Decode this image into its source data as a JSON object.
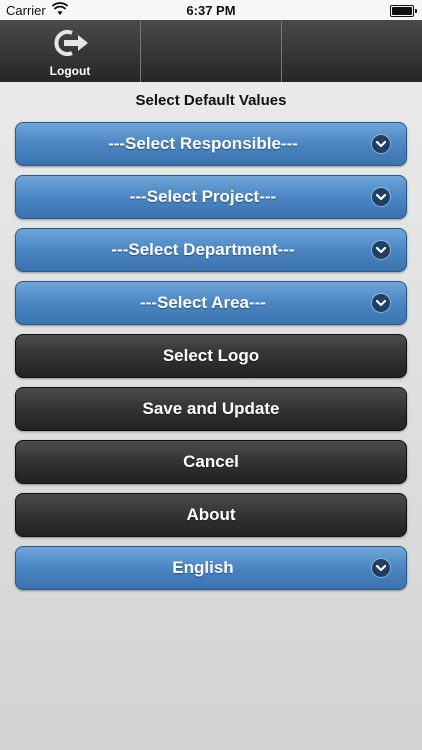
{
  "status_bar": {
    "carrier": "Carrier",
    "time": "6:37 PM"
  },
  "toolbar": {
    "logout_label": "Logout"
  },
  "title": "Select Default Values",
  "selects": {
    "responsible": "---Select Responsible---",
    "project": "---Select Project---",
    "department": "---Select Department---",
    "area": "---Select Area---",
    "language": "English"
  },
  "buttons": {
    "logo": "Select Logo",
    "save": "Save and Update",
    "cancel": "Cancel",
    "about": "About"
  },
  "colors": {
    "select_blue": "#4a86c4",
    "dark_button": "#333333",
    "toolbar": "#333333"
  }
}
